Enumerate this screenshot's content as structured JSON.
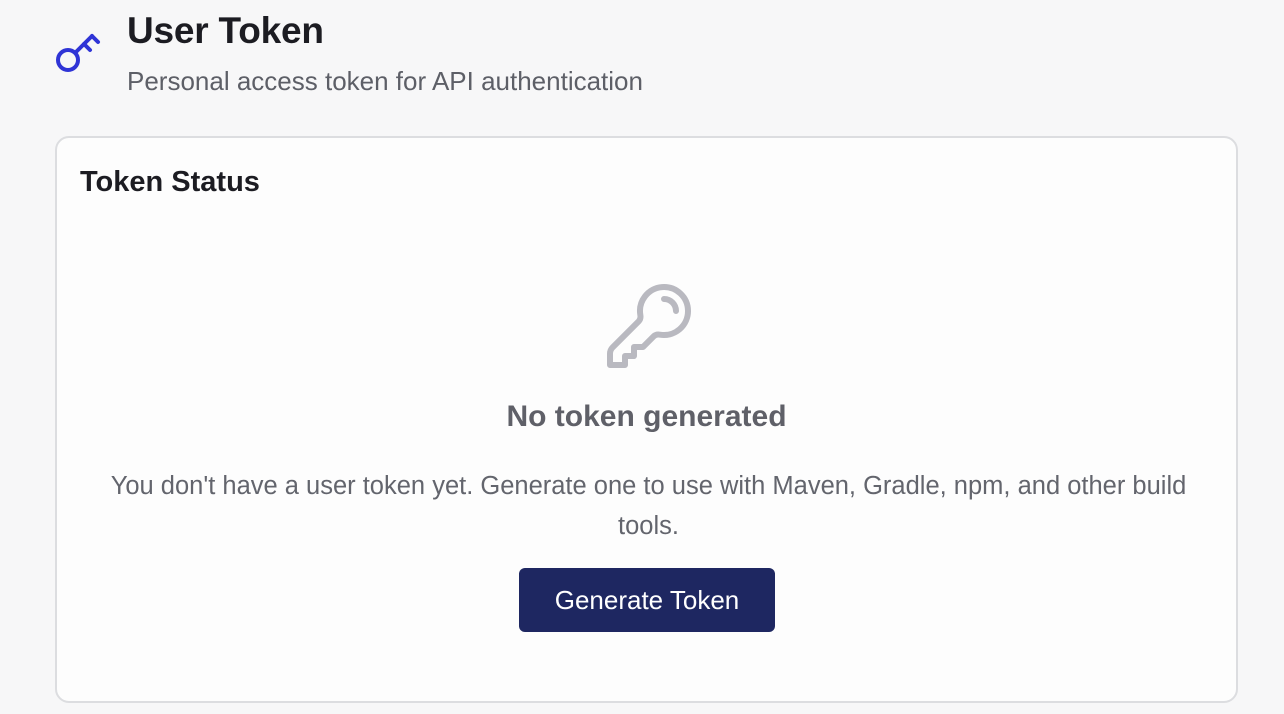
{
  "header": {
    "title": "User Token",
    "subtitle": "Personal access token for API authentication",
    "icon": "key-icon",
    "icon_color": "#2f34d6"
  },
  "status_card": {
    "title": "Token Status",
    "empty_state": {
      "icon": "key-icon",
      "icon_color": "#b9b9c0",
      "title": "No token generated",
      "description": "You don't have a user token yet. Generate one to use with Maven, Gradle, npm, and other build tools."
    },
    "generate_button_label": "Generate Token",
    "button_color": "#1e2761"
  }
}
